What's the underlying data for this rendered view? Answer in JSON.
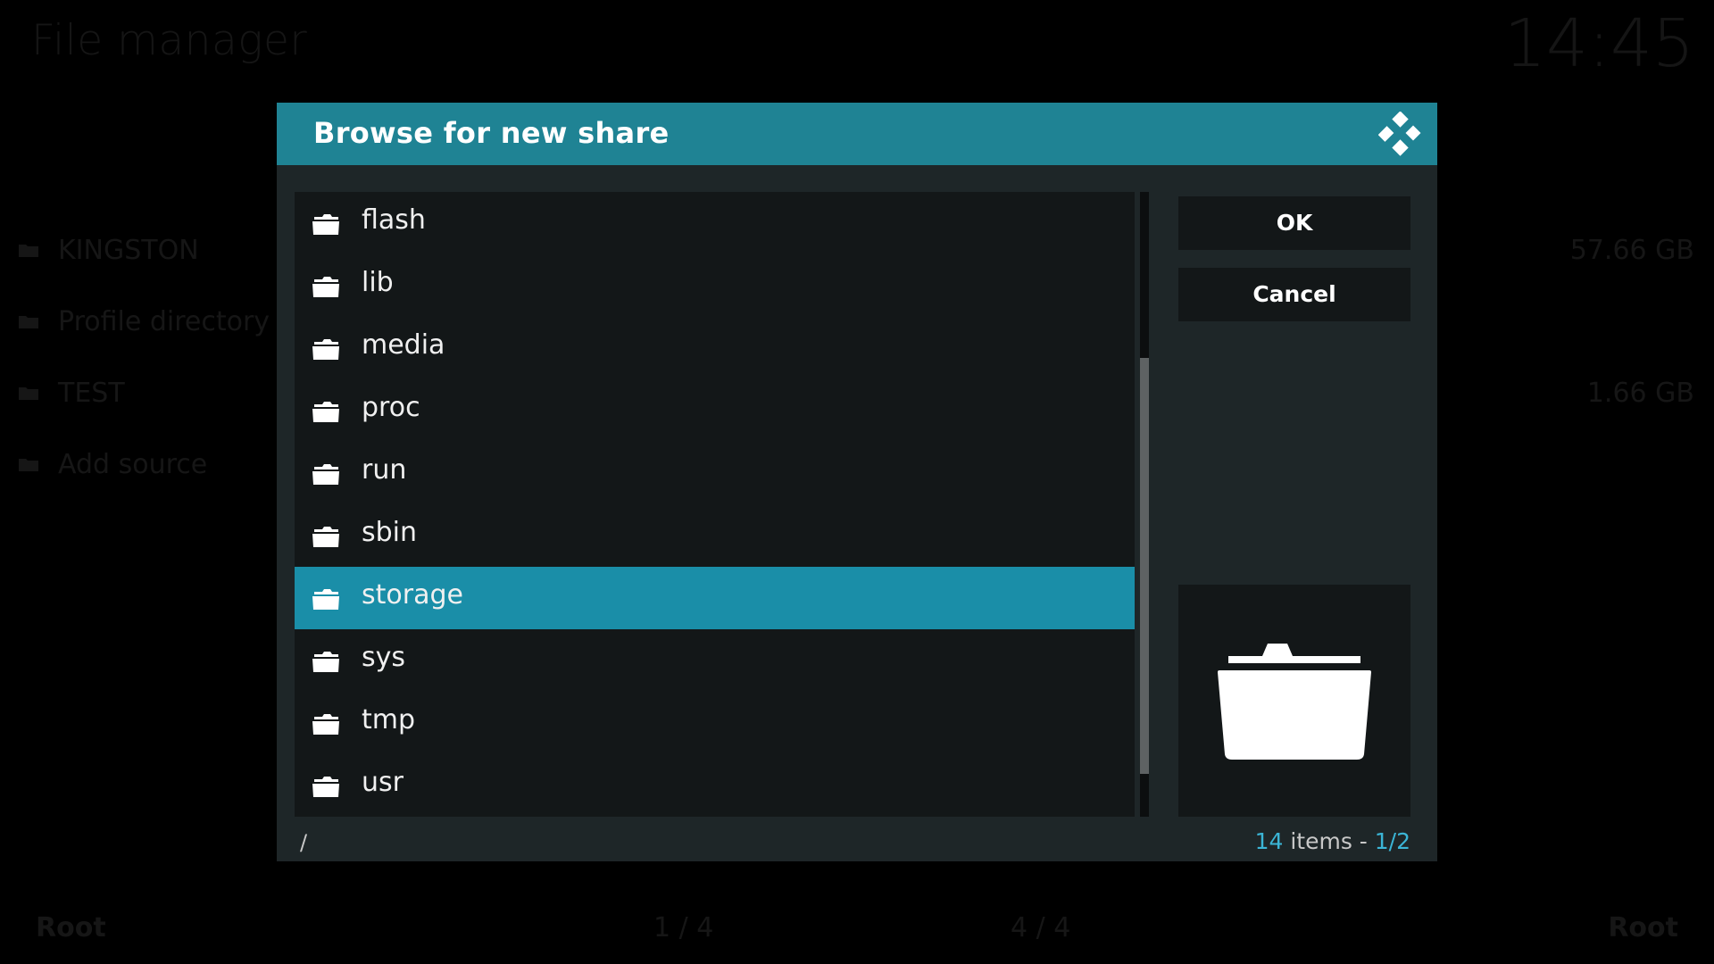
{
  "background": {
    "title": "File manager",
    "clock": "14:45",
    "sources": [
      {
        "label": "KINGSTON",
        "size": "57.66 GB"
      },
      {
        "label": "Profile directory",
        "size": ""
      },
      {
        "label": "TEST",
        "size": "1.66 GB"
      },
      {
        "label": "Add source",
        "size": ""
      }
    ],
    "footer": {
      "left_label": "Root",
      "left_page": "1 / 4",
      "right_page": "4 / 4",
      "right_label": "Root"
    }
  },
  "dialog": {
    "title": "Browse for new share",
    "logo_icon": "kodi-logo-icon",
    "items": [
      {
        "label": "flash"
      },
      {
        "label": "lib"
      },
      {
        "label": "media"
      },
      {
        "label": "proc"
      },
      {
        "label": "run"
      },
      {
        "label": "sbin"
      },
      {
        "label": "storage",
        "selected": true
      },
      {
        "label": "sys"
      },
      {
        "label": "tmp"
      },
      {
        "label": "usr"
      }
    ],
    "buttons": {
      "ok_label": "OK",
      "cancel_label": "Cancel"
    },
    "path": "/",
    "count": {
      "items": "14",
      "items_word": " items - ",
      "page": "1/2"
    },
    "preview_icon": "folder-open-icon"
  },
  "colors": {
    "header": "#1f8394",
    "selected": "#1a8ea8",
    "accent": "#3bb5d6",
    "dialog_bg": "#1e2628",
    "panel_bg": "#131718"
  }
}
